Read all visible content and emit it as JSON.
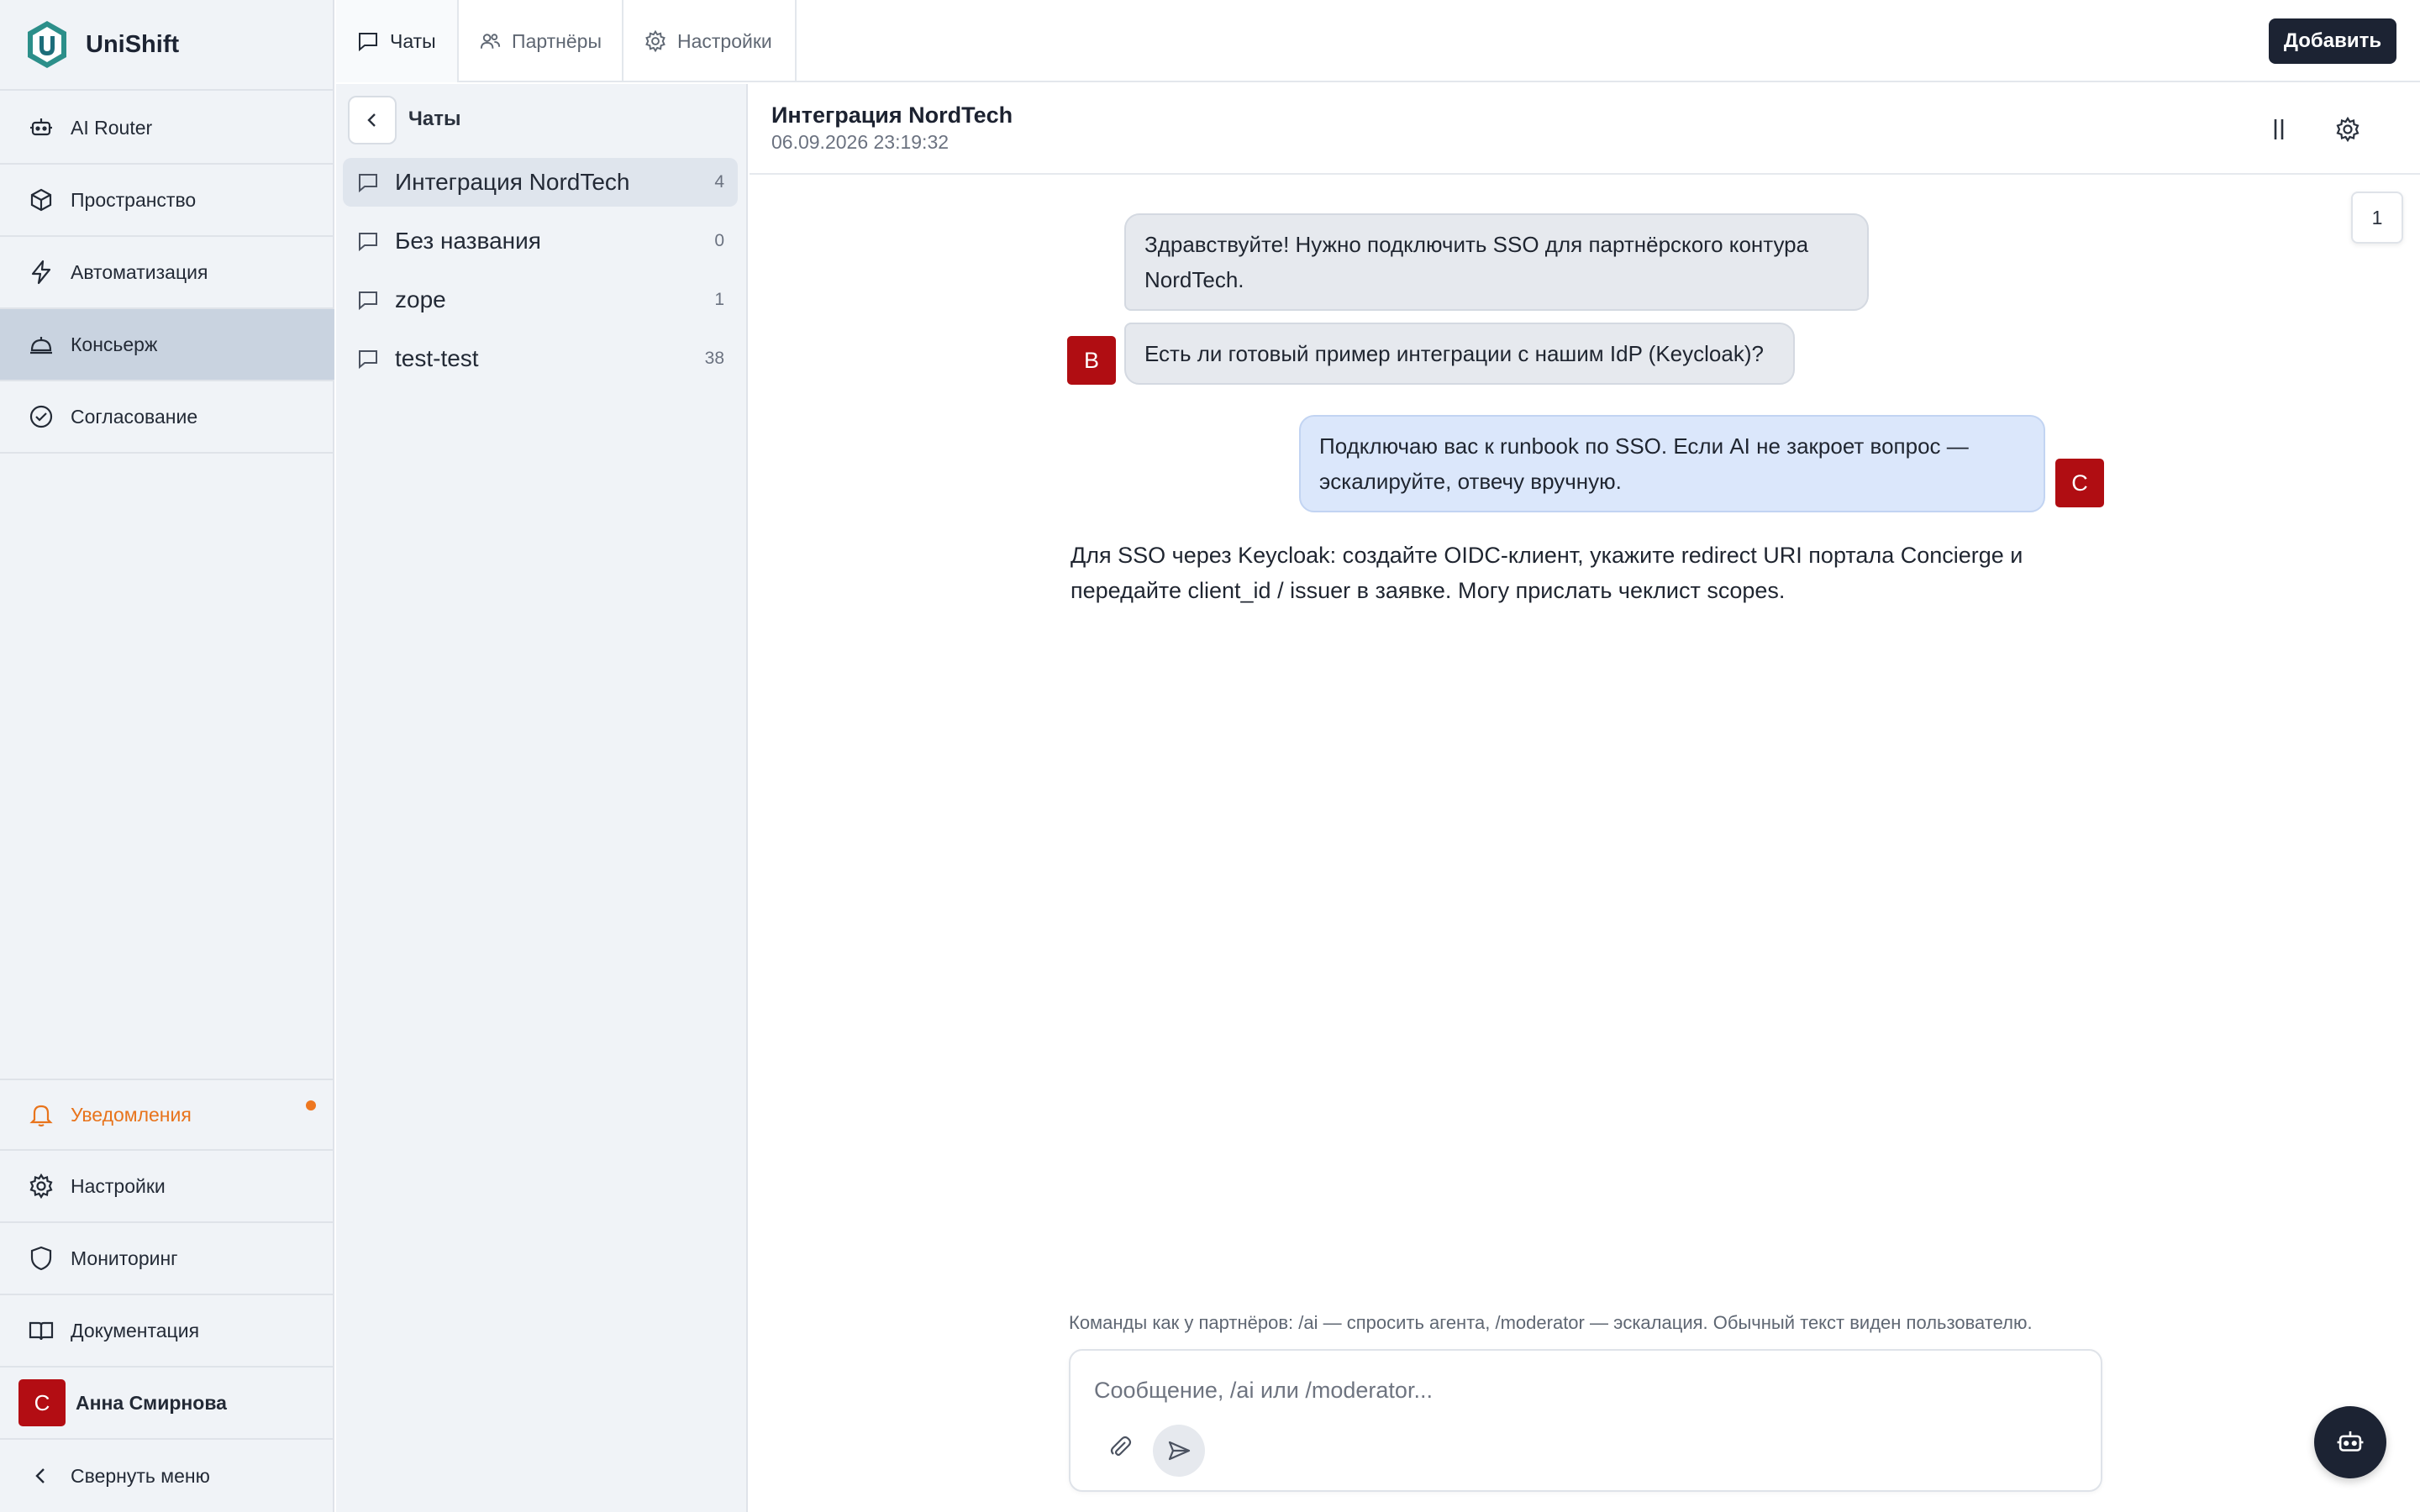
{
  "brand": {
    "name": "UniShift"
  },
  "sidebar": {
    "items": [
      {
        "label": "AI Router",
        "icon": "bot-icon"
      },
      {
        "label": "Пространство",
        "icon": "cube-icon"
      },
      {
        "label": "Автоматизация",
        "icon": "lightning-icon"
      },
      {
        "label": "Консьерж",
        "icon": "concierge-bell-icon",
        "active": true
      },
      {
        "label": "Согласование",
        "icon": "check-circle-icon"
      }
    ],
    "bottom": {
      "notifications": "Уведомления",
      "settings": "Настройки",
      "monitoring": "Мониторинг",
      "docs": "Документация",
      "user_initial": "С",
      "user_name": "Анна Смирнова",
      "collapse": "Свернуть меню"
    }
  },
  "topbar": {
    "tabs": [
      {
        "label": "Чаты",
        "icon": "chat-icon",
        "active": true
      },
      {
        "label": "Партнёры",
        "icon": "users-icon"
      },
      {
        "label": "Настройки",
        "icon": "gear-icon"
      }
    ],
    "add_label": "Добавить"
  },
  "chatlist": {
    "title": "Чаты",
    "items": [
      {
        "title": "Интеграция NordTech",
        "count": "4"
      },
      {
        "title": "Без названия",
        "count": "0"
      },
      {
        "title": "zope",
        "count": "1"
      },
      {
        "title": "test-test",
        "count": "38"
      }
    ]
  },
  "conversation": {
    "title": "Интеграция NordTech",
    "date": "06.09.2026 23:19:32",
    "page": "1",
    "messages": {
      "m1_line1": "Здравствуйте! Нужно подключить SSO для партнёрского контура",
      "m1_line2": "NordTech.",
      "m2": "Есть ли готовый пример интеграции с нашим IdP (Keycloak)?",
      "m3_line1": "Подключаю вас к runbook по SSO. Если AI не закроет вопрос —",
      "m3_line2": "эскалируйте, отвечу вручную.",
      "ai_line1": "Для SSO через Keycloak: создайте OIDC-клиент, укажите redirect URI портала Concierge и",
      "ai_line2": "передайте client_id / issuer в заявке. Могу прислать чеклист scopes."
    },
    "partner_initial": "В",
    "agent_initial": "С",
    "hint": "Команды как у партнёров: /ai — спросить агента, /moderator — эскалация. Обычный текст виден пользователю.",
    "composer_placeholder": "Сообщение, /ai или /moderator..."
  },
  "colors": {
    "accent_dark": "#1c2333",
    "avatar_red": "#b00d12",
    "notify_orange": "#e8741c",
    "sidebar_bg": "#f0f3f7",
    "active_bg": "#c9d3e0",
    "outgoing_bubble": "#dbe7fb",
    "brand_teal": "#2c8f8a"
  }
}
